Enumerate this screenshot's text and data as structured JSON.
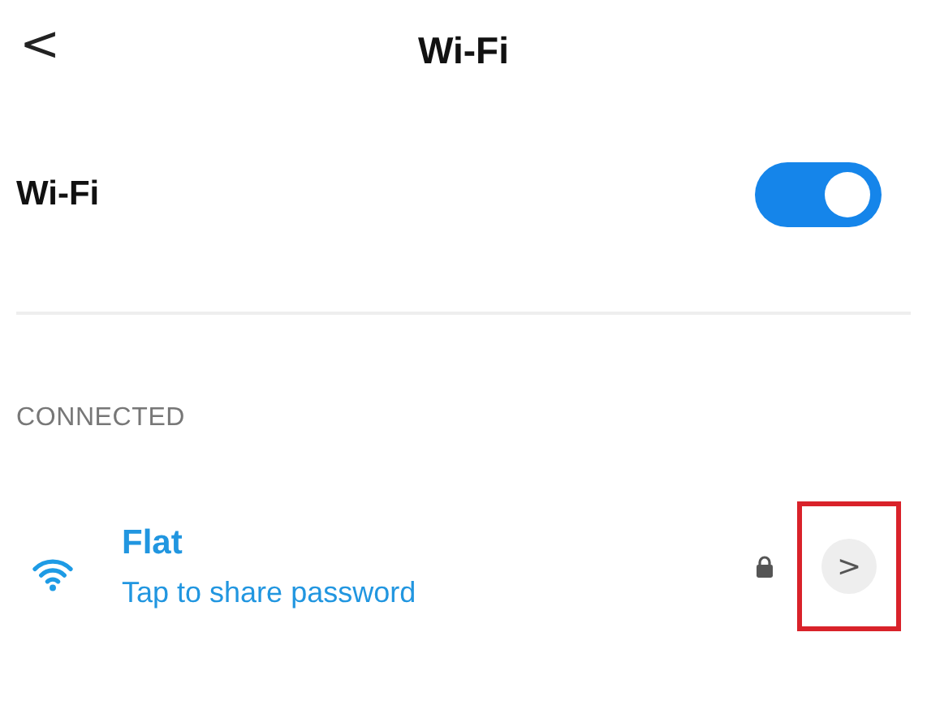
{
  "header": {
    "back": "<",
    "title": "Wi-Fi"
  },
  "wifi_switch": {
    "label": "Wi-Fi",
    "on": true
  },
  "section": {
    "title": "CONNECTED"
  },
  "networks": [
    {
      "name": "Flat",
      "subtitle": "Tap to share password",
      "secured": true,
      "details": ">",
      "highlighted": true
    }
  ]
}
